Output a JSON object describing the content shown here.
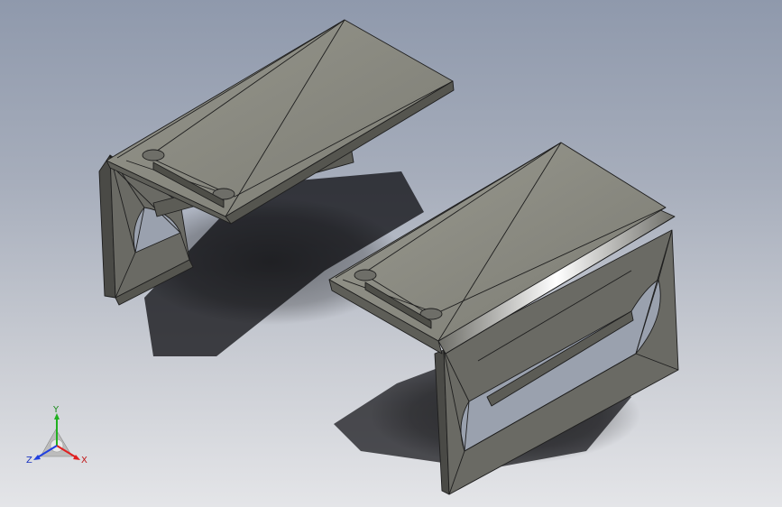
{
  "viewport": {
    "background_top": "#8f99ac",
    "background_bottom": "#e4e5e8"
  },
  "model": {
    "part_count": 2,
    "face_color": "#8a8a82",
    "edge_color": "#1e1e1e"
  },
  "triad": {
    "x_label": "X",
    "y_label": "Y",
    "z_label": "Z",
    "x_color": "#e02020",
    "y_color": "#20b020",
    "z_color": "#2040e0"
  }
}
